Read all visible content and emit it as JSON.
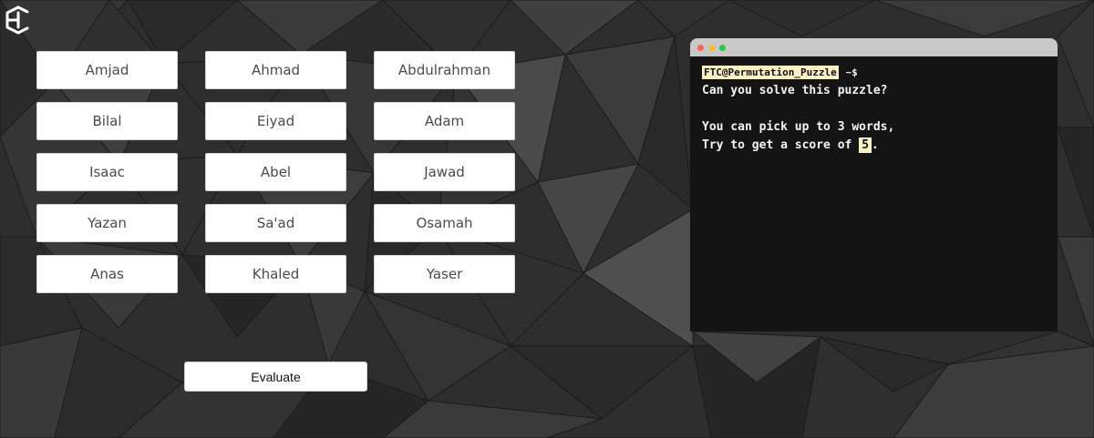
{
  "names": [
    {
      "label": "Amjad"
    },
    {
      "label": "Ahmad"
    },
    {
      "label": "Abdulrahman"
    },
    {
      "label": "Bilal"
    },
    {
      "label": "Eiyad"
    },
    {
      "label": "Adam"
    },
    {
      "label": "Isaac"
    },
    {
      "label": "Abel"
    },
    {
      "label": "Jawad"
    },
    {
      "label": "Yazan"
    },
    {
      "label": "Sa'ad"
    },
    {
      "label": "Osamah"
    },
    {
      "label": "Anas"
    },
    {
      "label": "Khaled"
    },
    {
      "label": "Yaser"
    }
  ],
  "evaluate_label": "Evaluate",
  "terminal": {
    "prompt_host": "FTC@Permutation_Puzzle",
    "prompt_symbol": "~$",
    "question": "Can you solve this puzzle?",
    "rule_line": "You can pick up to 3 words,",
    "goal_prefix": "Try to get a score of ",
    "goal_score": "5",
    "goal_suffix": ".",
    "window_dots": [
      {
        "name": "close",
        "color": "#ff5f57"
      },
      {
        "name": "minimize",
        "color": "#febc2e"
      },
      {
        "name": "maximize",
        "color": "#28c840"
      }
    ]
  },
  "colors": {
    "background": "#2e2e2e",
    "terminal_background": "#141414",
    "terminal_titlebar": "#c8c8c8",
    "highlight": "#fbf1c7",
    "button_text": "#4a4a4a"
  },
  "icons": {
    "logo": "ec-logo-icon"
  }
}
